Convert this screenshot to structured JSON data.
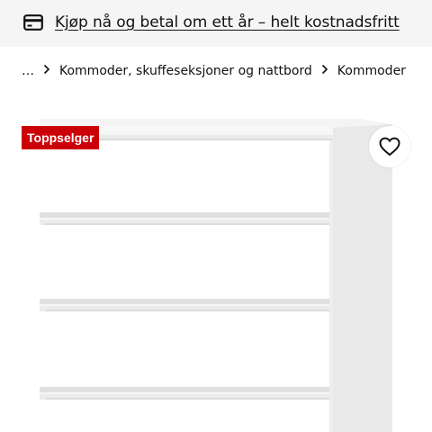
{
  "promo": {
    "icon": "credit-card-icon",
    "text": "Kjøp nå og betal om ett år – helt kostnadsfritt"
  },
  "breadcrumb": {
    "ellipsis": "…",
    "items": [
      "Kommoder, skuffeseksjoner og nattbord",
      "Kommoder"
    ],
    "separator_icon": "chevron-right-icon"
  },
  "product": {
    "badge": "Toppselger",
    "favorite_icon": "heart-outline-icon",
    "image": "white-dresser-with-drawers"
  },
  "colors": {
    "promo_bg": "#f5f5f5",
    "badge_bg": "#cc0008",
    "badge_text": "#ffffff"
  }
}
